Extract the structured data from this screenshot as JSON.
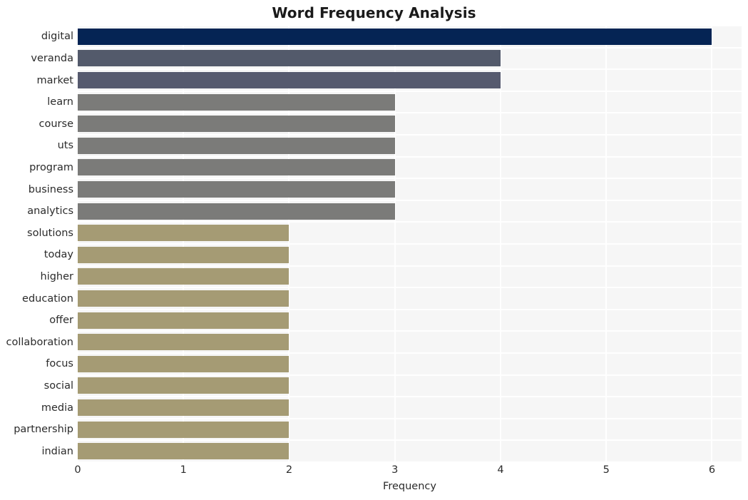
{
  "chart_data": {
    "type": "bar",
    "orientation": "horizontal",
    "title": "Word Frequency Analysis",
    "xlabel": "Frequency",
    "ylabel": "",
    "xlim": [
      0,
      6.28
    ],
    "xticks": [
      0,
      1,
      2,
      3,
      4,
      5,
      6
    ],
    "xticklabels": [
      "0",
      "1",
      "2",
      "3",
      "4",
      "5",
      "6"
    ],
    "grid": true,
    "grid_color": "#ffffff",
    "plot_background": "#f6f6f6",
    "figure_background": "#ffffff",
    "legend": null,
    "categories": [
      "digital",
      "veranda",
      "market",
      "learn",
      "course",
      "uts",
      "program",
      "business",
      "analytics",
      "solutions",
      "today",
      "higher",
      "education",
      "offer",
      "collaboration",
      "focus",
      "social",
      "media",
      "partnership",
      "indian"
    ],
    "values": [
      6,
      4,
      4,
      3,
      3,
      3,
      3,
      3,
      3,
      2,
      2,
      2,
      2,
      2,
      2,
      2,
      2,
      2,
      2,
      2
    ],
    "bar_colors": [
      "#052454",
      "#535a6b",
      "#565a6e",
      "#7b7b79",
      "#7b7b79",
      "#7b7b79",
      "#7b7b79",
      "#7b7b79",
      "#7b7b79",
      "#a59b74",
      "#a59b74",
      "#a59b74",
      "#a59b74",
      "#a59b74",
      "#a59b74",
      "#a59b74",
      "#a59b74",
      "#a59b74",
      "#a59b74",
      "#a59b74"
    ]
  }
}
